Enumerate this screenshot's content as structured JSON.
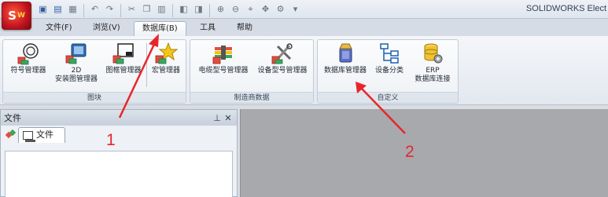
{
  "app": {
    "logo_text": "S",
    "logo_sub": "W",
    "title": "SOLIDWORKS Elect"
  },
  "quick_access": {
    "icons": [
      "new-icon",
      "save-icon",
      "print-icon",
      "undo-icon",
      "redo-icon",
      "cut-icon",
      "copy-icon",
      "paste-icon",
      "previous-icon",
      "next-icon",
      "zoom-in-icon",
      "zoom-out-icon",
      "fit-icon",
      "pan-icon",
      "settings-icon",
      "dropdown-icon"
    ]
  },
  "tabs": [
    {
      "label": "文件(F)"
    },
    {
      "label": "浏览(V)"
    },
    {
      "label": "数据库(B)",
      "active": true
    },
    {
      "label": "工具"
    },
    {
      "label": "帮助"
    }
  ],
  "ribbon": {
    "groups": {
      "block": {
        "label": "图块",
        "buttons": {
          "symbol": "符号管理器",
          "install_line1": "2D",
          "install_line2": "安装图管理器",
          "frame": "图框管理器",
          "macro": "宏管理器"
        }
      },
      "manufacturer": {
        "label": "制造商数据",
        "buttons": {
          "cable": "电缆型号管理器",
          "device": "设备型号管理器"
        }
      },
      "custom": {
        "label": "自定义",
        "buttons": {
          "db_manager": "数据库管理器",
          "device_class": "设备分类",
          "erp_line1": "ERP",
          "erp_line2": "数据库连接"
        }
      }
    }
  },
  "panel": {
    "title": "文件",
    "pin_icon": "pin-icon",
    "close_icon": "close-icon",
    "tab_label": "文件"
  },
  "annotations": {
    "color": "#e8262a",
    "arrow1_number": "1",
    "arrow2_number": "2"
  }
}
